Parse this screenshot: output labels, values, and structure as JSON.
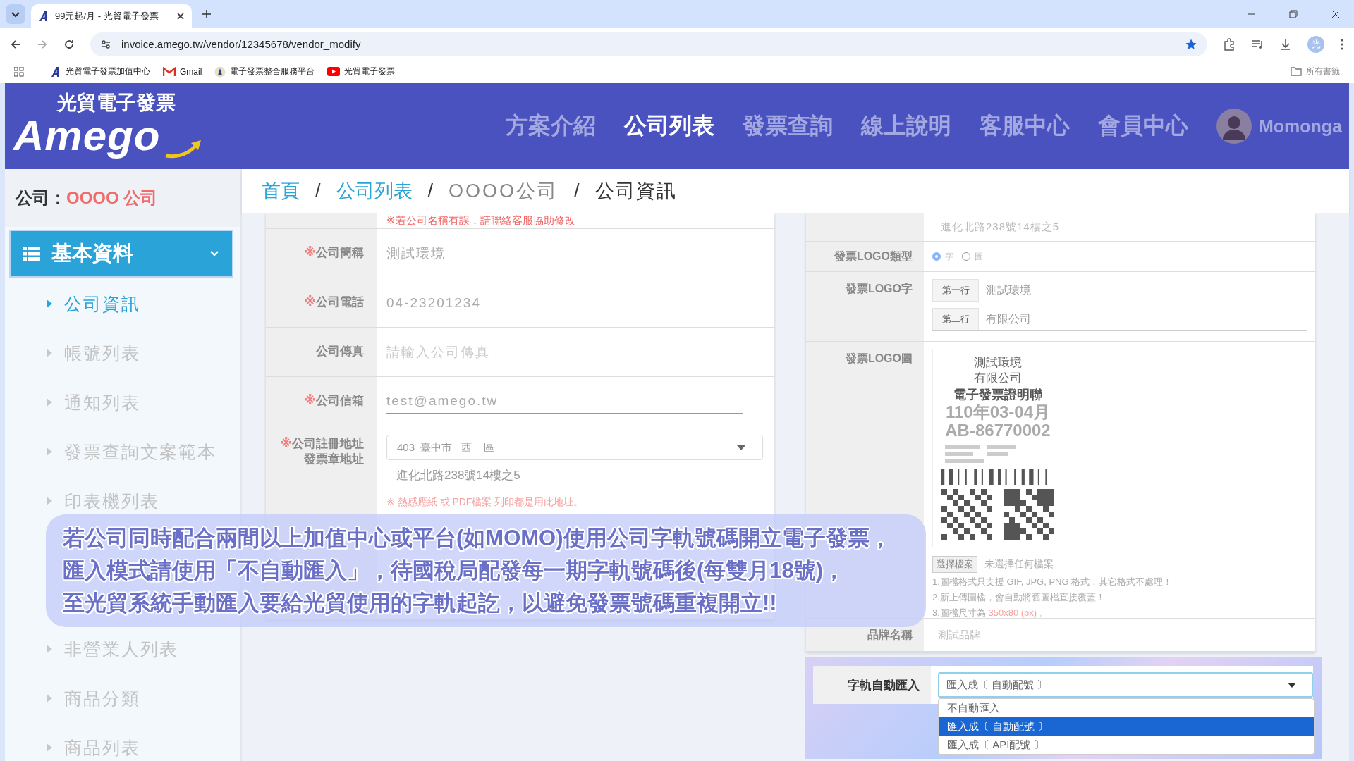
{
  "browser": {
    "tabs": [
      {
        "title": "99元起/月 - 光貿電子發票",
        "selected": true
      }
    ],
    "url": "invoice.amego.tw/vendor/12345678/vendor_modify",
    "profile_initial": "光",
    "bookmarks": [
      {
        "label": "光貿電子發票加值中心",
        "kind": "amego"
      },
      {
        "label": "Gmail",
        "kind": "gmail"
      },
      {
        "label": "電子發票整合服務平台",
        "kind": "gov"
      },
      {
        "label": "光貿電子發票",
        "kind": "youtube"
      }
    ],
    "all_bookmarks": "所有書籤"
  },
  "header": {
    "logo_caption": "光貿電子發票",
    "logo_word": "Amego",
    "nav": [
      {
        "label": "方案介紹",
        "selected": false
      },
      {
        "label": "公司列表",
        "selected": true
      },
      {
        "label": "發票查詢",
        "selected": false
      },
      {
        "label": "線上說明",
        "selected": false
      },
      {
        "label": "客服中心",
        "selected": false
      },
      {
        "label": "會員中心",
        "selected": false
      }
    ],
    "user": "Momonga"
  },
  "sidebar": {
    "company_label": "公司：",
    "company_name": "OOOO 公司",
    "section": "基本資料",
    "expanded": true,
    "items": [
      {
        "label": "公司資訊",
        "selected": true
      },
      {
        "label": "帳號列表",
        "selected": false
      },
      {
        "label": "通知列表",
        "selected": false
      },
      {
        "label": "發票查詢文案範本",
        "selected": false
      },
      {
        "label": "印表機列表",
        "selected": false
      },
      {
        "label": "非營業人列表",
        "selected": false
      },
      {
        "label": "商品分類",
        "selected": false
      },
      {
        "label": "商品列表",
        "selected": false
      }
    ]
  },
  "breadcrumb": [
    {
      "label": "首頁",
      "kind": "link"
    },
    {
      "label": "公司列表",
      "kind": "link"
    },
    {
      "label": "OOOO公司",
      "kind": "muted"
    },
    {
      "label": "公司資訊",
      "kind": "current"
    }
  ],
  "breadcrumb_separator": "/",
  "left_form": {
    "notice": "※若公司名稱有誤，請聯絡客服協助修改",
    "rows": [
      {
        "mark": "※",
        "label": "公司簡稱",
        "kind": "text",
        "value": "測試環境"
      },
      {
        "mark": "※",
        "label": "公司電話",
        "kind": "text",
        "value": "04-23201234"
      },
      {
        "label": "公司傳真",
        "kind": "placeholder",
        "placeholder": "請輸入公司傳真"
      },
      {
        "mark": "※",
        "label": "公司信箱",
        "kind": "underline",
        "value": "test@amego.tw"
      }
    ],
    "address": {
      "mark": "※",
      "label": "公司註冊地址",
      "label_2": "發票章地址",
      "select": "403  臺中市   西    區",
      "street": "進化北路238號14樓之5",
      "note": "※ 熱感應紙 或 PDF檔案 列印都是用此地址。"
    }
  },
  "right_form": {
    "address_tail": "進化北路238號14樓之5",
    "logo_type": {
      "label": "發票LOGO類型",
      "options": [
        {
          "label": "字",
          "selected": true
        },
        {
          "label": "圖",
          "selected": false
        }
      ]
    },
    "logo_text": {
      "label": "發票LOGO字",
      "lines": [
        {
          "label": "第一行",
          "value": "測試環境"
        },
        {
          "label": "第二行",
          "value": "有限公司"
        }
      ]
    },
    "logo_image": {
      "label": "發票LOGO圖",
      "preview": [
        "測試環境",
        "有限公司"
      ],
      "preview_title": "電子發票證明聯",
      "preview_period": "110年03-04月",
      "preview_number": "AB-86770002",
      "file_button": "選擇檔案",
      "file_status": "未選擇任何檔案",
      "notes": [
        {
          "text": "1.圖檔格式只支援 GIF, JPG, PNG 格式，其它格式不處理！"
        },
        {
          "text": "2.新上傳圖檔，會自動將舊圖檔直接覆蓋！"
        },
        {
          "text": "3.圖檔尺寸為 ",
          "highlight": "350x80 (px)",
          "tail": " 。"
        }
      ]
    },
    "brand": {
      "label": "品牌名稱",
      "value": "測試品牌"
    },
    "auto_import": {
      "label": "字軌自動匯入",
      "value": "匯入成〔 自動配號 〕",
      "expanded": true,
      "options": [
        {
          "label": "不自動匯入",
          "selected": false
        },
        {
          "label": "匯入成〔 自動配號 〕",
          "selected": true
        },
        {
          "label": "匯入成〔 API配號 〕",
          "selected": false
        }
      ]
    }
  },
  "banner": {
    "lines": [
      "若公司同時配合兩間以上加值中心或平台(如MOMO)使用公司字軌號碼開立電子發票，",
      "匯入模式請使用「不自動匯入」，待國稅局配發每一期字軌號碼後(每雙月18號)，",
      "至光貿系統手動匯入要給光貿使用的字軌起訖，以避免發票號碼重複開立!!"
    ]
  }
}
